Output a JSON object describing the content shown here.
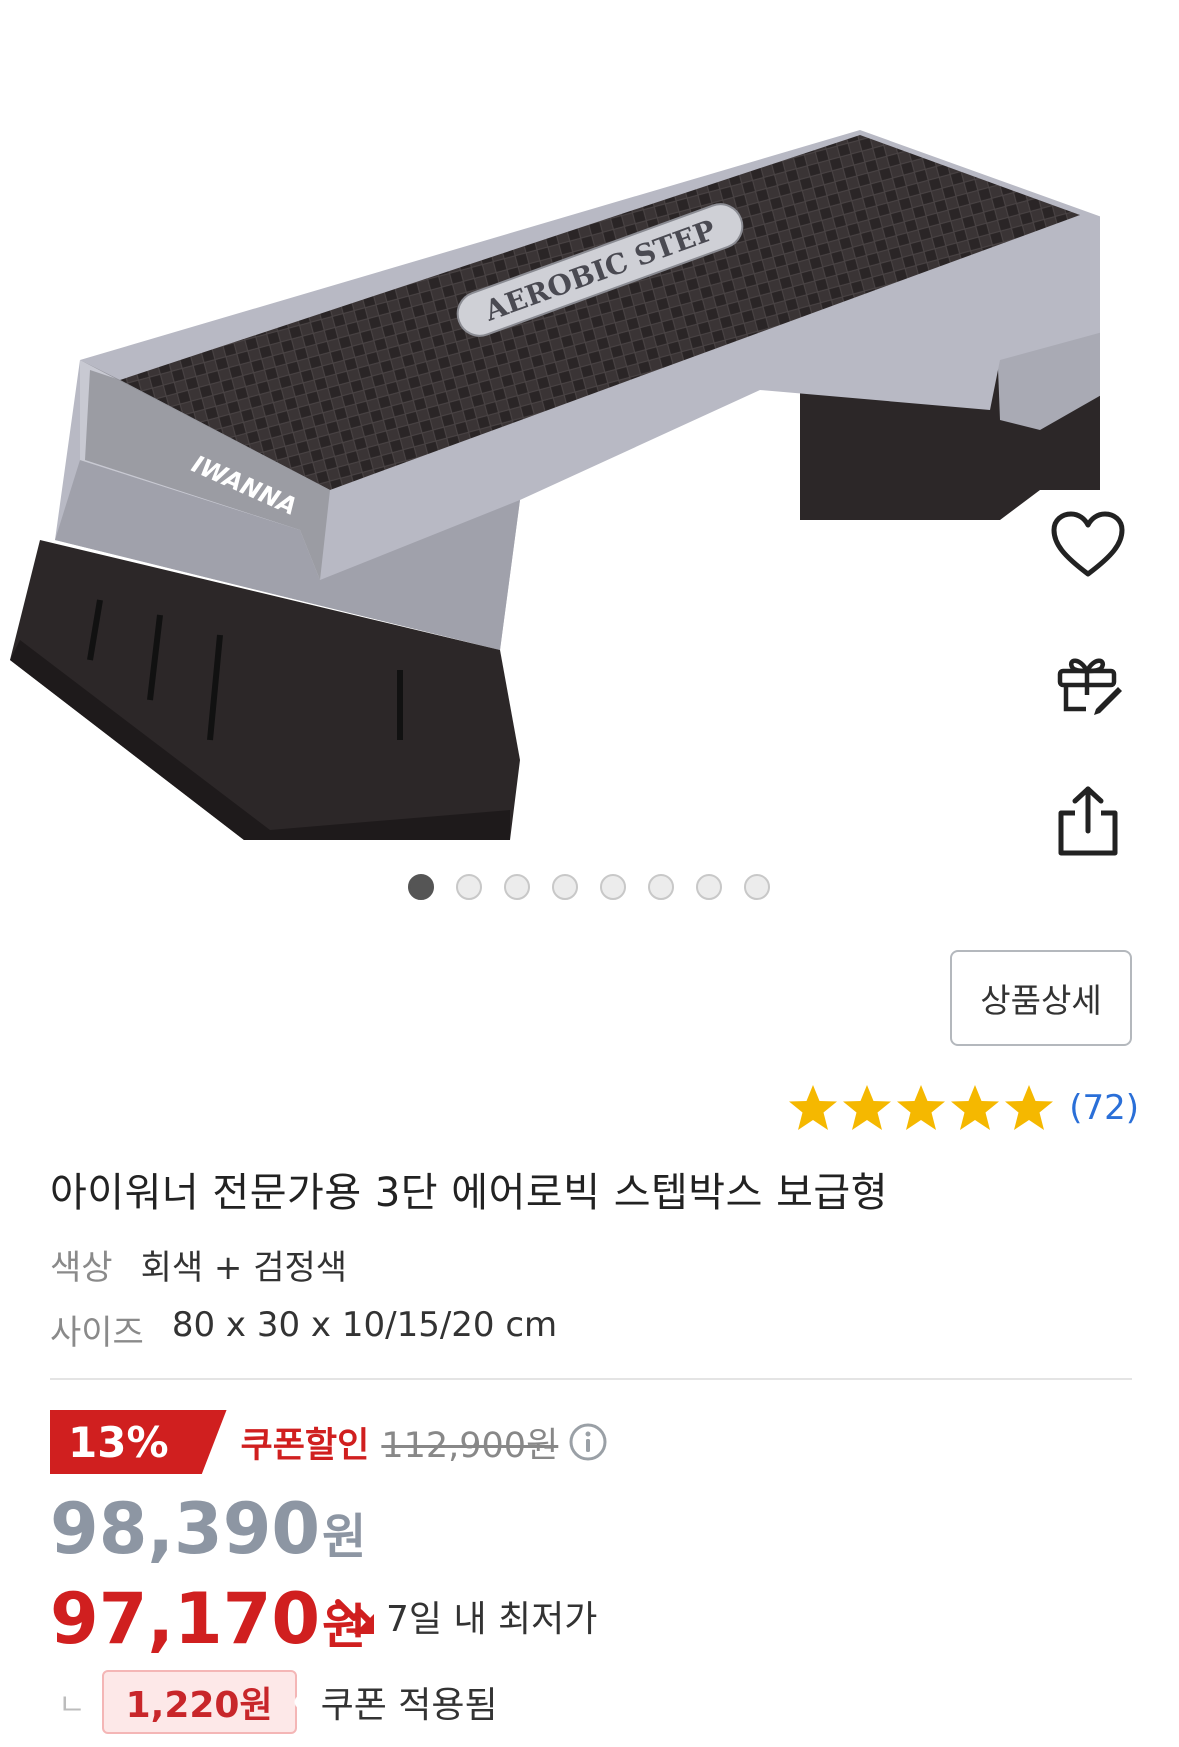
{
  "product": {
    "image_count": 8,
    "active_image_index": 0,
    "title": "아이워너 전문가용 3단 에어로빅 스텝박스 보급형",
    "detail_button": "상품상세",
    "rating": {
      "stars": 5,
      "max_stars": 5,
      "count_text": "(72)"
    },
    "options": [
      {
        "label": "색상",
        "value": "회색 + 검정색"
      },
      {
        "label": "사이즈",
        "value": "80 x 30 x 10/15/20 cm"
      }
    ],
    "image_text": {
      "aerobic": "AEROBIC STEP",
      "brand": "IWANNA"
    }
  },
  "price": {
    "discount_rate": "13%",
    "coupon_label": "쿠폰할인",
    "original": "112,900원",
    "sale_num": "98,390",
    "sale_unit": "원",
    "final_num": "97,170",
    "final_unit": "원",
    "lowest_label": "7일 내 최저가",
    "coupon_amount": "1,220원",
    "coupon_applied": "쿠폰 적용됨",
    "branch_mark": "ㄴ"
  },
  "actions": {
    "wishlist": "heart-icon",
    "gift": "gift-icon",
    "share": "share-icon"
  },
  "colors": {
    "accent_red": "#d01f1f",
    "link_blue": "#2a6fd8",
    "star_gold": "#f5b800",
    "sale_gray": "#8d96a3"
  }
}
